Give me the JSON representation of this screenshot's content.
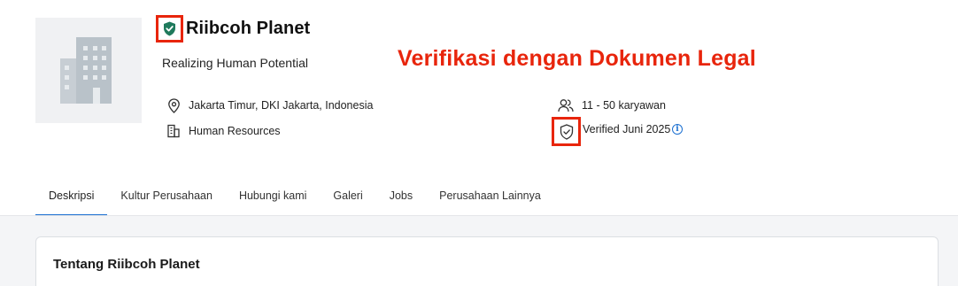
{
  "company": {
    "name": "Riibcoh Planet",
    "tagline": "Realizing Human Potential",
    "location": "Jakarta Timur, DKI Jakarta, Indonesia",
    "industry": "Human Resources",
    "size": "11 - 50 karyawan",
    "verified": "Verified Juni 2025"
  },
  "annotation": "Verifikasi dengan Dokumen Legal",
  "tabs": [
    {
      "label": "Deskripsi"
    },
    {
      "label": "Kultur Perusahaan"
    },
    {
      "label": "Hubungi kami"
    },
    {
      "label": "Galeri"
    },
    {
      "label": "Jobs"
    },
    {
      "label": "Perusahaan Lainnya"
    }
  ],
  "active_tab": "Deskripsi",
  "card": {
    "title": "Tentang Riibcoh Planet"
  },
  "icons": {
    "verified_badge": "shield-check-icon",
    "location": "map-pin-icon",
    "industry": "building-icon",
    "size": "users-icon",
    "verified": "shield-check-outline-icon",
    "info": "info-icon"
  },
  "colors": {
    "accent": "#1a6fd1",
    "annotation": "#e8250c",
    "verified_badge": "#1f7a5c"
  }
}
